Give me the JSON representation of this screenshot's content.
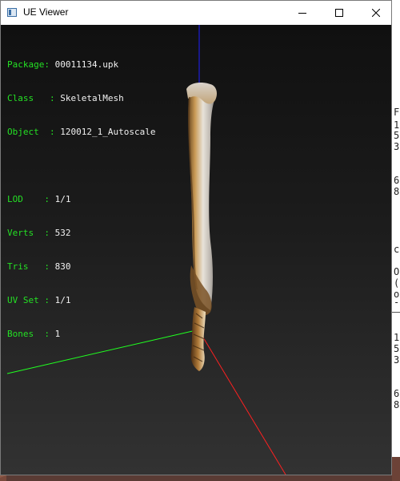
{
  "window": {
    "title": "UE Viewer",
    "controls": {
      "minimize": "minimize",
      "maximize": "maximize",
      "close": "close"
    }
  },
  "info": {
    "package_label": "Package",
    "package_value": "00011134.upk",
    "class_label": "Class",
    "class_value": "SkeletalMesh",
    "object_label": "Object",
    "object_value": "120012_1_Autoscale",
    "lod_label": "LOD",
    "lod_value": "1/1",
    "verts_label": "Verts",
    "verts_value": "532",
    "tris_label": "Tris",
    "tris_value": "830",
    "uvset_label": "UV Set",
    "uvset_value": "1/1",
    "bones_label": "Bones",
    "bones_value": "1"
  },
  "background_window_text": [
    "F",
    "1",
    "5",
    "3",
    "6",
    "8",
    "c",
    "O",
    "(",
    "o",
    "-",
    "1",
    "5",
    "3",
    "6",
    "8"
  ],
  "colors": {
    "axis_x": "#ff2020",
    "axis_y": "#20ff20",
    "axis_z": "#2020ff",
    "info_label": "#24e024",
    "info_value": "#f0f0f0"
  }
}
